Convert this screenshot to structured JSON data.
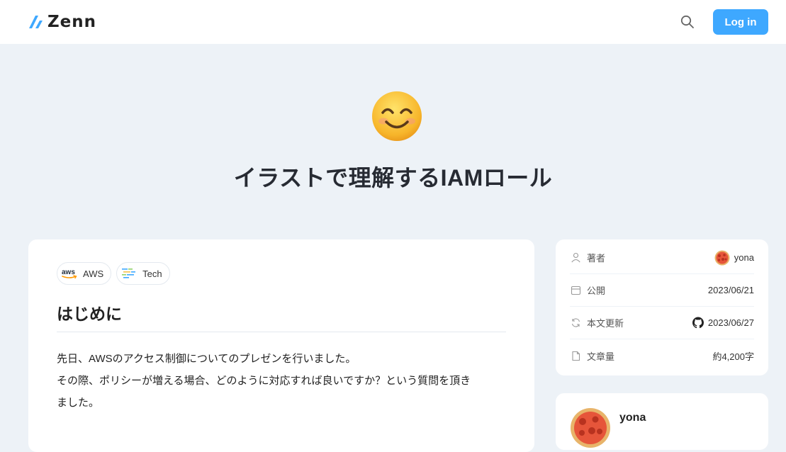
{
  "header": {
    "logo_text": "Zenn",
    "login_label": "Log in",
    "brand_color": "#3ea8ff",
    "search_icon": "search-icon"
  },
  "hero": {
    "emoji": "smiling-face-icon",
    "title": "イラストで理解するIAMロール"
  },
  "article": {
    "topics": [
      {
        "label": "AWS",
        "icon": "aws-icon"
      },
      {
        "label": "Tech",
        "icon": "tech-icon"
      }
    ],
    "heading": "はじめに",
    "paragraph_lines": [
      "先日、AWSのアクセス制御についてのプレゼンを行いました。",
      "その際、ポリシーが増える場合、どのように対応すれば良いですか？という質問を頂き",
      "ました。"
    ]
  },
  "info": {
    "author_label": "著者",
    "author_name": "yona",
    "published_label": "公開",
    "published_date": "2023/06/21",
    "updated_label": "本文更新",
    "updated_date": "2023/06/27",
    "length_label": "文章量",
    "length_value": "約4,200字"
  },
  "author_card": {
    "name": "yona"
  }
}
